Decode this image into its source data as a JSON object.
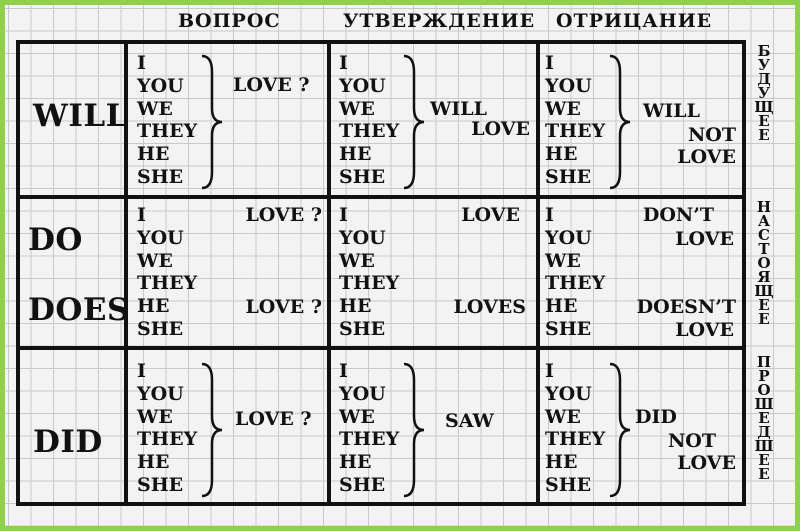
{
  "headers": {
    "question": "ВОПРОС",
    "affirmative": "УТВЕРЖДЕНИЕ",
    "negative": "ОТРИЦАНИЕ"
  },
  "side_labels": {
    "future": [
      "Б",
      "У",
      "Д",
      "У",
      "Щ",
      "Е",
      "Е"
    ],
    "present": [
      "Н",
      "А",
      "С",
      "Т",
      "О",
      "Я",
      "Щ",
      "Е",
      "Е"
    ],
    "past": [
      "П",
      "Р",
      "О",
      "Ш",
      "Е",
      "Д",
      "Ш",
      "Е",
      "Е"
    ]
  },
  "rows": {
    "future": {
      "aux": "WILL",
      "pronouns": [
        "I",
        "YOU",
        "WE",
        "THEY",
        "HE",
        "SHE"
      ],
      "question": "LOVE ?",
      "affirmative": [
        "WILL",
        "LOVE"
      ],
      "negative": [
        "WILL",
        "NOT",
        "LOVE"
      ]
    },
    "present": {
      "aux_do": "DO",
      "aux_does": "DOES",
      "pronouns": [
        "I",
        "YOU",
        "WE",
        "THEY",
        "HE",
        "SHE"
      ],
      "question_do": "LOVE ?",
      "question_does": "LOVE ?",
      "affirmative_plain": "LOVE",
      "affirmative_s": "LOVES",
      "negative_dont": [
        "DON’T",
        "LOVE"
      ],
      "negative_doesnt": [
        "DOESN’T",
        "LOVE"
      ]
    },
    "past": {
      "aux": "DID",
      "pronouns": [
        "I",
        "YOU",
        "WE",
        "THEY",
        "HE",
        "SHE"
      ],
      "question": "LOVE ?",
      "affirmative": "SAW",
      "negative": [
        "DID",
        "NOT",
        "LOVE"
      ]
    }
  }
}
